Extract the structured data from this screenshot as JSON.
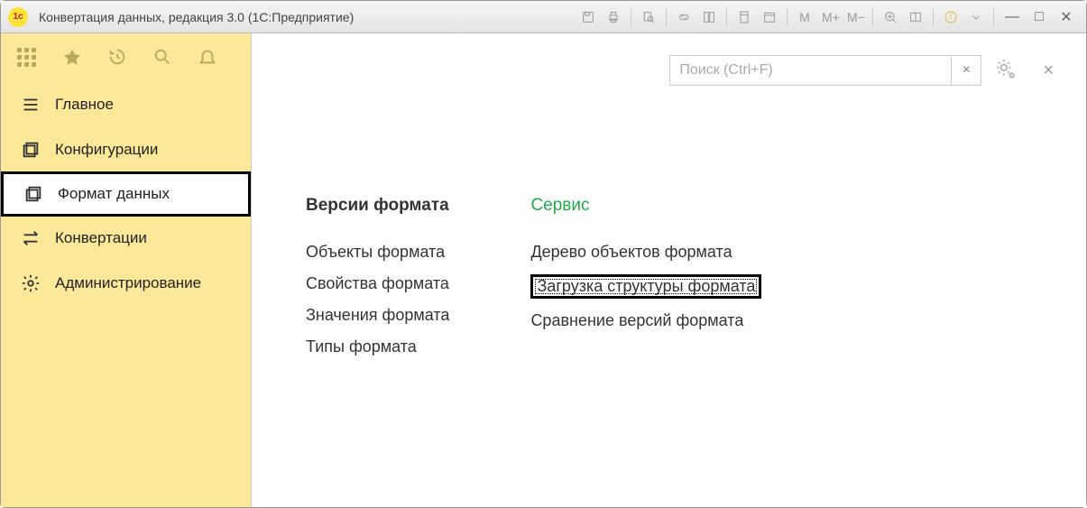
{
  "window": {
    "logo_text": "1c",
    "title": "Конвертация данных, редакция 3.0  (1С:Предприятие)"
  },
  "titlebar_icons": {
    "m1": "M",
    "m2": "M+",
    "m3": "M−"
  },
  "window_controls": {
    "min": "—",
    "max": "□",
    "close": "✕"
  },
  "side_nav": {
    "items": [
      {
        "label": "Главное"
      },
      {
        "label": "Конфигурации"
      },
      {
        "label": "Формат данных"
      },
      {
        "label": "Конвертации"
      },
      {
        "label": "Администрирование"
      }
    ]
  },
  "search": {
    "placeholder": "Поиск (Ctrl+F)",
    "clear": "×"
  },
  "panel_close": "×",
  "columns": {
    "left": {
      "title": "Версии формата",
      "links": [
        "Объекты формата",
        "Свойства формата",
        "Значения формата",
        "Типы формата"
      ]
    },
    "right": {
      "title": "Сервис",
      "links": [
        "Дерево объектов формата",
        "Загрузка структуры формата",
        "Сравнение версий формата"
      ]
    }
  }
}
